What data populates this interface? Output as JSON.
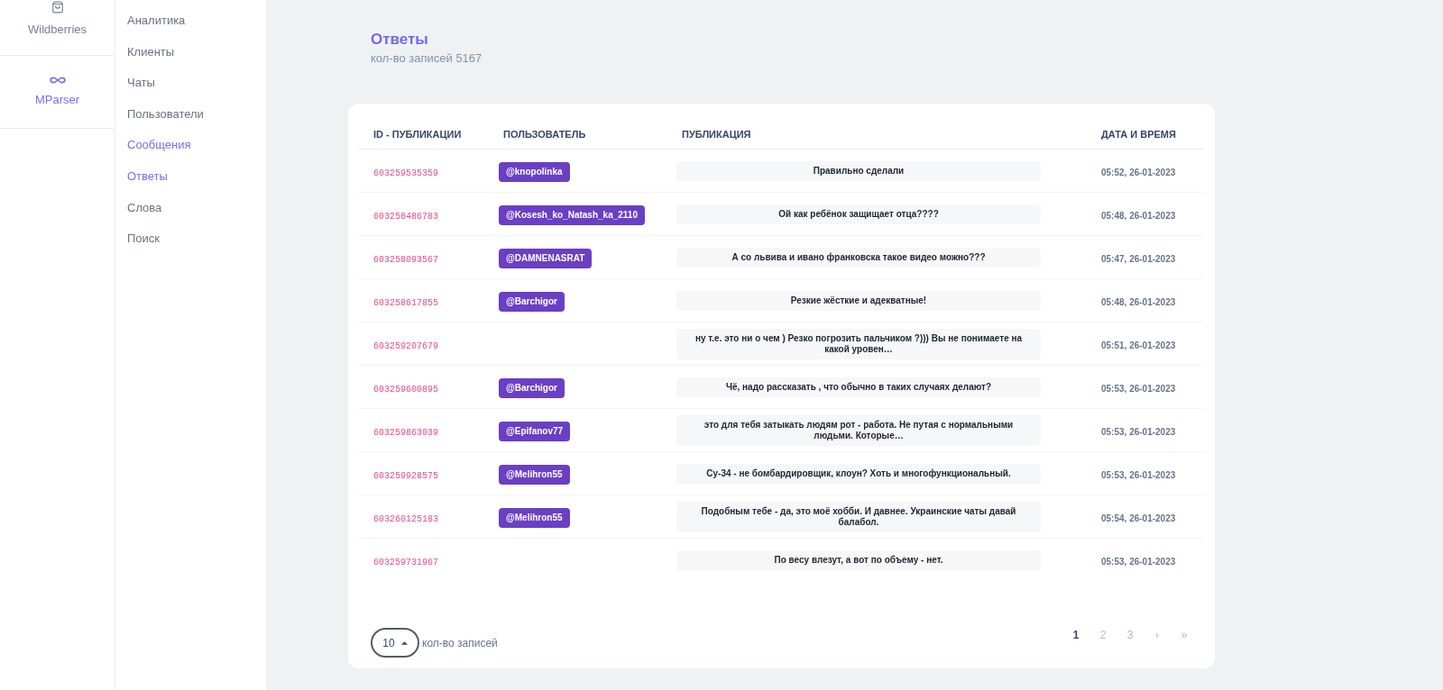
{
  "rail": {
    "items": [
      {
        "label": "Wildberries",
        "selected": false
      },
      {
        "label": "MParser",
        "selected": true
      }
    ]
  },
  "nav": {
    "items": [
      {
        "label": "Аналитика",
        "selected": false
      },
      {
        "label": "Клиенты",
        "selected": false
      },
      {
        "label": "Чаты",
        "selected": false
      },
      {
        "label": "Пользователи",
        "selected": false
      },
      {
        "label": "Сообщения",
        "selected": true
      },
      {
        "label": "Ответы",
        "selected": true
      },
      {
        "label": "Слова",
        "selected": false
      },
      {
        "label": "Поиск",
        "selected": false
      }
    ]
  },
  "page": {
    "title": "Ответы",
    "subtitle": "кол-во записей 5167"
  },
  "table": {
    "columns": [
      "ID - ПУБЛИКАЦИИ",
      "ПОЛЬЗОВАТЕЛЬ",
      "ПУБЛИКАЦИЯ",
      "ДАТА И ВРЕМЯ"
    ],
    "rows": [
      {
        "id": "603259535359",
        "user": "@knopolinka",
        "text": "Правильно сделали",
        "datetime": "05:52, 26-01-2023"
      },
      {
        "id": "603258486783",
        "user": "@Kosesh_ko_Natash_ka_2110",
        "text": "Ой как ребёнок защищает отца????",
        "datetime": "05:48, 26-01-2023"
      },
      {
        "id": "603258093567",
        "user": "@DAMNENASRAT",
        "text": "А со львива и ивано франковска такое видео можно???",
        "datetime": "05:47, 26-01-2023"
      },
      {
        "id": "603258617855",
        "user": "@Barchigor",
        "text": "Резкие жёсткие и адекватные!",
        "datetime": "05:48, 26-01-2023"
      },
      {
        "id": "603259207679",
        "text": "ну т.е. это ни о чем ) Резко погрозить пальчиком ?))) Вы не понимаете на какой уровен…",
        "datetime": "05:51, 26-01-2023"
      },
      {
        "id": "603259600895",
        "user": "@Barchigor",
        "text": "Чё, надо рассказать , что обычно в таких случаях делают?",
        "datetime": "05:53, 26-01-2023"
      },
      {
        "id": "603259863039",
        "user": "@Epifanov77",
        "text": "это для тебя затыкать людям рот - работа. Не путая с нормальными людьми. Которые…",
        "datetime": "05:53, 26-01-2023"
      },
      {
        "id": "603259928575",
        "user": "@Melihron55",
        "text": "Су-34 - не бомбардировщик, клоун? Хоть и многофункциональный.",
        "datetime": "05:53, 26-01-2023"
      },
      {
        "id": "603260125183",
        "user": "@Melihron55",
        "text": "Подобным тебе - да, это моё хобби. И давнее. Украинские чаты давай балабол.",
        "datetime": "05:54, 26-01-2023"
      },
      {
        "id": "603259731967",
        "text": "По весу влезут, а вот по объему - нет.",
        "datetime": "05:53, 26-01-2023"
      }
    ]
  },
  "pagination": {
    "page_size": "10",
    "page_size_label": "кол-во записей",
    "pages": [
      {
        "label": "1",
        "selected": true
      },
      {
        "label": "2",
        "selected": false
      },
      {
        "label": "3",
        "selected": false
      },
      {
        "label": "›",
        "selected": false
      },
      {
        "label": "»",
        "selected": false
      }
    ]
  }
}
